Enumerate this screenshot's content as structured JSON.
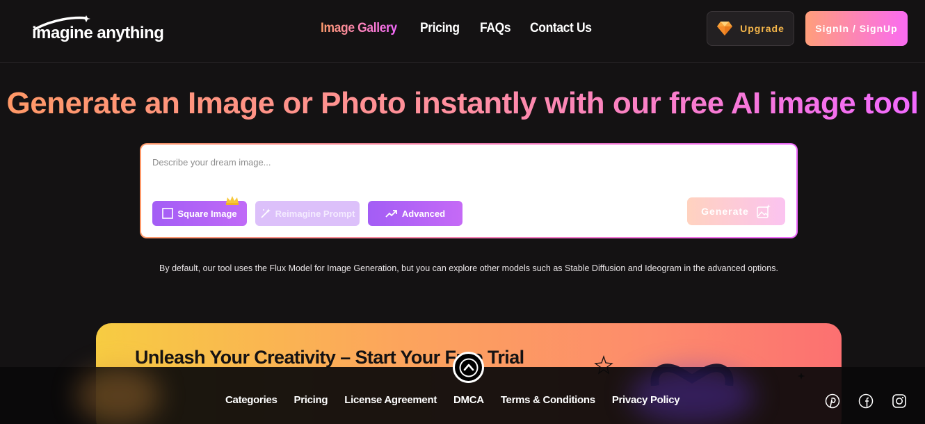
{
  "header": {
    "logo_text": "imagine anything",
    "nav": [
      {
        "label": "Image Gallery",
        "active": true
      },
      {
        "label": "Pricing",
        "active": false
      },
      {
        "label": "FAQs",
        "active": false
      },
      {
        "label": "Contact Us",
        "active": false
      }
    ],
    "upgrade_label": "Upgrade",
    "signin_label": "SignIn / SignUp"
  },
  "hero": {
    "title_part1": "Generate an Image or Photo instantly with our free AI image tool",
    "prompt_placeholder": "Describe your dream image...",
    "chips": {
      "square": "Square Image",
      "reimagine": "Reimagine Prompt",
      "advanced": "Advanced"
    },
    "generate_label": "Generate",
    "note": "By default, our tool uses the Flux Model for Image Generation, but you can explore other models such as Stable Diffusion and Ideogram in the advanced options."
  },
  "promo": {
    "title": "Unleash Your Creativity – Start Your Free Trial"
  },
  "footer": {
    "links": [
      "Categories",
      "Pricing",
      "License Agreement",
      "DMCA",
      "Terms & Conditions",
      "Privacy Policy"
    ],
    "social_icons": [
      "pinterest-icon",
      "facebook-icon",
      "instagram-icon"
    ]
  },
  "colors": {
    "background": "#141213",
    "accent_orange": "#ff9867",
    "accent_pink": "#f269ff",
    "chip_purple": "#a35df5",
    "upgrade_gold": "#f5b64a"
  }
}
